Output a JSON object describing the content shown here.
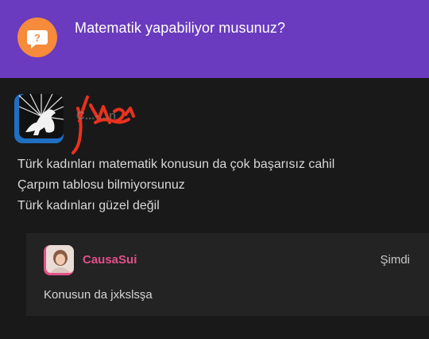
{
  "colors": {
    "header_bg": "#6a3bbf",
    "question_icon": "#f58b3b",
    "comment_username": "#e2508a",
    "body_bg": "#191919"
  },
  "header": {
    "icon": "question-bubble-icon",
    "title": "Matematik yapabiliyor musunuz?"
  },
  "post": {
    "author": "C...-...n",
    "lines": [
      "Türk kadınları matematik konusun da çok başarısız cahil",
      "Çarpım tablosu bilmiyorsunuz",
      "Türk kadınları güzel değil"
    ]
  },
  "comment": {
    "username": "CausaSui",
    "time": "Şimdi",
    "text": "Konusun da jxkslsşa"
  }
}
